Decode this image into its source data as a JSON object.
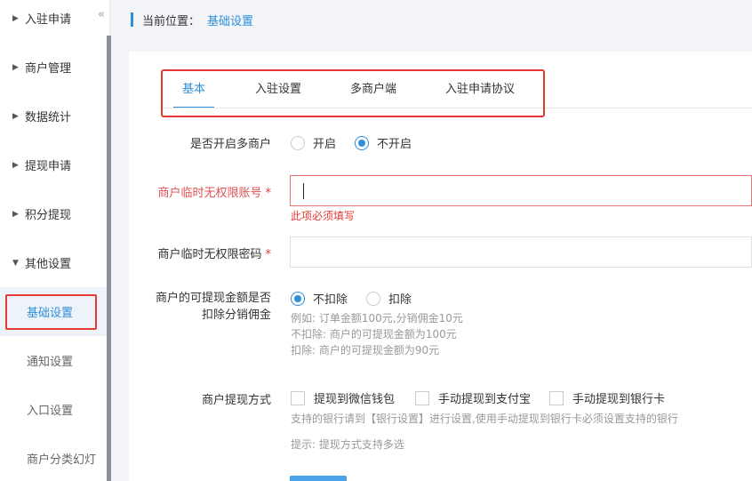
{
  "sidebar": {
    "items": [
      {
        "label": "入驻申请",
        "type": "group"
      },
      {
        "label": "商户管理",
        "type": "group"
      },
      {
        "label": "数据统计",
        "type": "group"
      },
      {
        "label": "提现申请",
        "type": "group"
      },
      {
        "label": "积分提现",
        "type": "group"
      },
      {
        "label": "其他设置",
        "type": "group-open"
      },
      {
        "label": "基础设置",
        "type": "sub-active"
      },
      {
        "label": "通知设置",
        "type": "sub"
      },
      {
        "label": "入口设置",
        "type": "sub"
      },
      {
        "label": "商户分类幻灯",
        "type": "sub"
      }
    ],
    "collapse_icon": "double-chevron-left"
  },
  "breadcrumb": {
    "label": "当前位置：",
    "current": "基础设置"
  },
  "tabs": [
    {
      "label": "基本",
      "active": true
    },
    {
      "label": "入驻设置",
      "active": false
    },
    {
      "label": "多商户端",
      "active": false
    },
    {
      "label": "入驻申请协议",
      "active": false
    }
  ],
  "form": {
    "multi_merchant": {
      "label": "是否开启多商户",
      "options": [
        "开启",
        "不开启"
      ],
      "selected": "不开启"
    },
    "temp_account": {
      "label": "商户临时无权限账号",
      "required": "*",
      "value": "",
      "error": "此项必须填写"
    },
    "temp_password": {
      "label": "商户临时无权限密码",
      "required": "*",
      "value": ""
    },
    "deduct_commission": {
      "label_line1": "商户的可提现金额是否",
      "label_line2": "扣除分销佣金",
      "options": [
        "不扣除",
        "扣除"
      ],
      "selected": "不扣除",
      "hints": [
        "例如: 订单金额100元,分销佣金10元",
        "不扣除: 商户的可提现金额为100元",
        "扣除: 商户的可提现金额为90元"
      ]
    },
    "withdraw_method": {
      "label": "商户提现方式",
      "options": [
        "提现到微信钱包",
        "手动提现到支付宝",
        "手动提现到银行卡"
      ],
      "hint1": "支持的银行请到【银行设置】进行设置,使用手动提现到银行卡必须设置支持的银行",
      "hint2": "提示: 提现方式支持多选"
    }
  },
  "colors": {
    "accent": "#2f8fd8",
    "error": "#e53935",
    "highlight_outline": "#e53935"
  }
}
